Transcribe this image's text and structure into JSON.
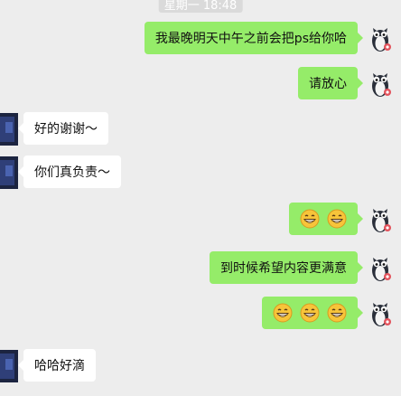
{
  "header": {
    "timestamp": "星期一 18:48"
  },
  "messages": [
    {
      "side": "right",
      "kind": "text",
      "text": "我最晚明天中午之前会把ps给你哈"
    },
    {
      "side": "right",
      "kind": "text",
      "text": "请放心"
    },
    {
      "side": "left",
      "kind": "text",
      "text": "好的谢谢～"
    },
    {
      "side": "left",
      "kind": "text",
      "text": "你们真负责～"
    },
    {
      "side": "right",
      "kind": "emoji",
      "emoji": "grinning-face",
      "count": 2
    },
    {
      "side": "right",
      "kind": "text",
      "text": "到时候希望内容更满意"
    },
    {
      "side": "right",
      "kind": "emoji",
      "emoji": "grinning-face",
      "count": 3
    },
    {
      "side": "left",
      "kind": "text",
      "text": "哈哈好滴"
    }
  ],
  "colors": {
    "background": "#ededed",
    "outgoing_bubble": "#95ec69",
    "incoming_bubble": "#ffffff",
    "timestamp_badge": "#dadada"
  }
}
